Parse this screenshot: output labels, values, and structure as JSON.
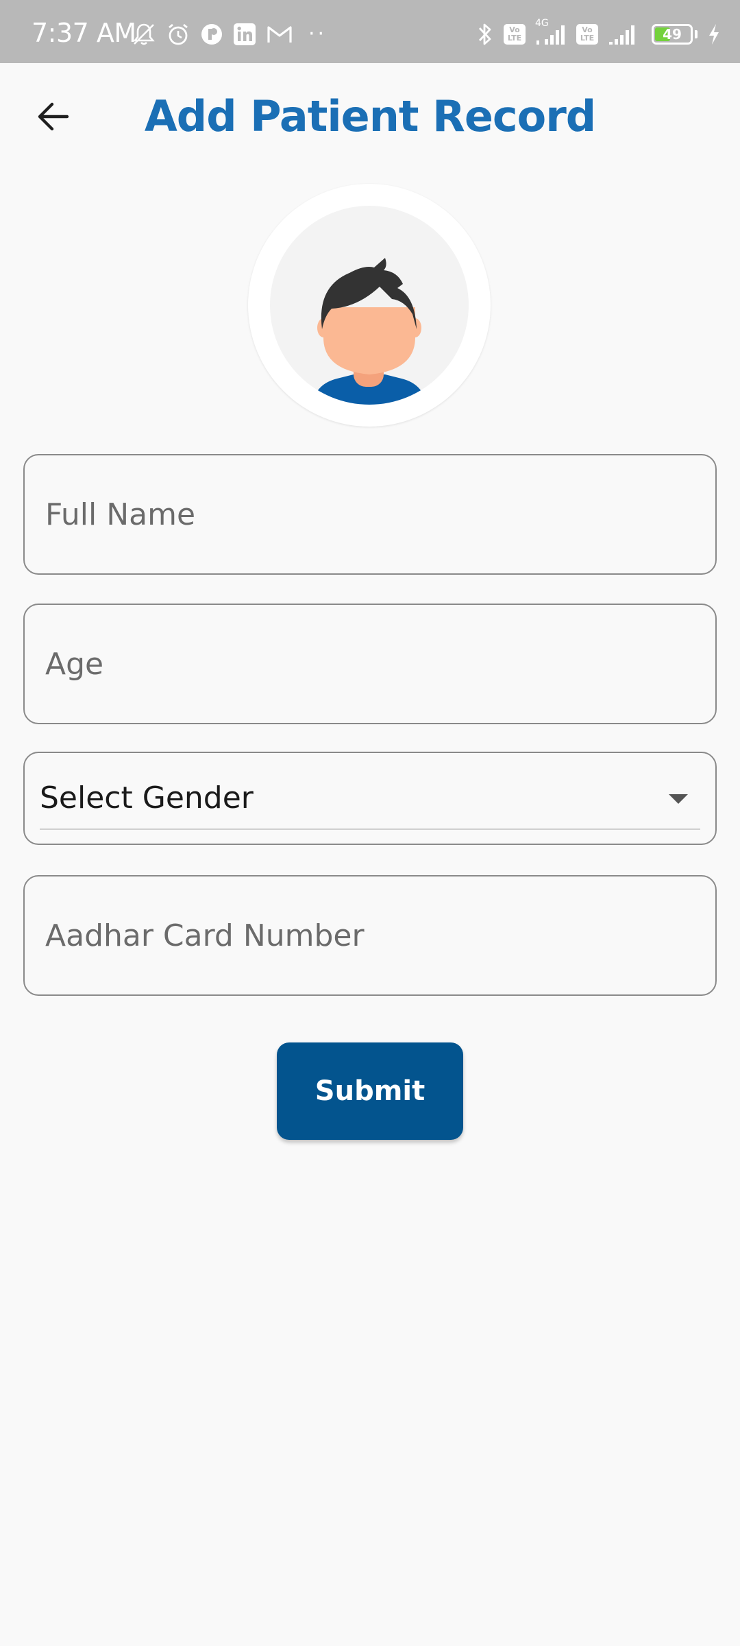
{
  "status_bar": {
    "time": "7:37 AM",
    "left_icons": [
      "mute-icon",
      "alarm-icon",
      "app-notification-icon",
      "linkedin-icon",
      "gmail-icon"
    ],
    "more_dots": "··",
    "network": "4G",
    "volte": "Vo LTE",
    "battery_level": "49",
    "right_icons": [
      "bluetooth-icon",
      "volte-icon",
      "signal-icon",
      "volte-icon",
      "signal-icon",
      "battery-icon",
      "charging-icon"
    ]
  },
  "app_bar": {
    "title": "Add Patient Record",
    "back_icon": "arrow-left-icon"
  },
  "avatar": {
    "icon": "person-avatar-icon",
    "colors": {
      "hair": "#333333",
      "skin": "#fbb893",
      "shirt": "#0a5ea8",
      "background": "#f3f3f3"
    }
  },
  "form": {
    "full_name": {
      "placeholder": "Full Name",
      "value": ""
    },
    "age": {
      "placeholder": "Age",
      "value": ""
    },
    "gender": {
      "label": "Select Gender",
      "icon": "dropdown-arrow-icon"
    },
    "aadhar": {
      "placeholder": "Aadhar Card Number",
      "value": ""
    },
    "submit_label": "Submit"
  },
  "colors": {
    "title": "#1b6fb5",
    "button": "#03548e",
    "status_bar": "#b8b8b8",
    "background": "#f9f9f9",
    "battery_fill": "#74d13c"
  }
}
